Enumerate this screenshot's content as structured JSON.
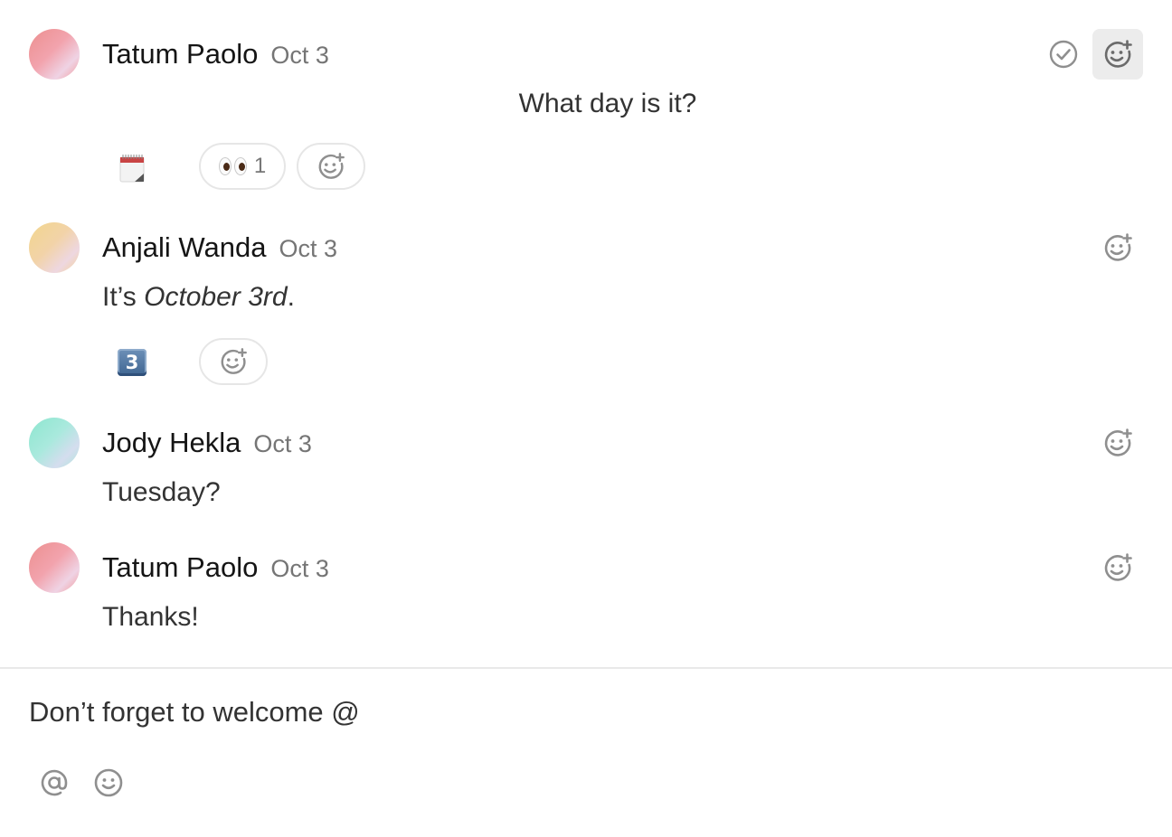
{
  "messages": [
    {
      "author": "Tatum Paolo",
      "date": "Oct 3",
      "text": "What day is it?",
      "reactions": [
        {
          "icon": "calendar-emoji"
        },
        {
          "icon": "eyes-emoji",
          "count": "1"
        }
      ]
    },
    {
      "author": "Anjali Wanda",
      "date": "Oct 3",
      "text_plain": "It’s ",
      "text_italic": "October 3rd",
      "text_end": ".",
      "reactions": [
        {
          "icon": "keycap-3-emoji",
          "glyph": "3"
        }
      ]
    },
    {
      "author": "Jody Hekla",
      "date": "Oct 3",
      "text": "Tuesday?"
    },
    {
      "author": "Tatum Paolo",
      "date": "Oct 3",
      "text": "Thanks!"
    }
  ],
  "composer": {
    "value": "Don’t forget to welcome @",
    "tools": [
      "at-icon",
      "smiley-icon"
    ]
  },
  "colors": {
    "muted_text": "#757575",
    "icon_gray": "#8f8f8f",
    "active_button_bg": "#ececec",
    "divider": "#e9e9e9"
  }
}
